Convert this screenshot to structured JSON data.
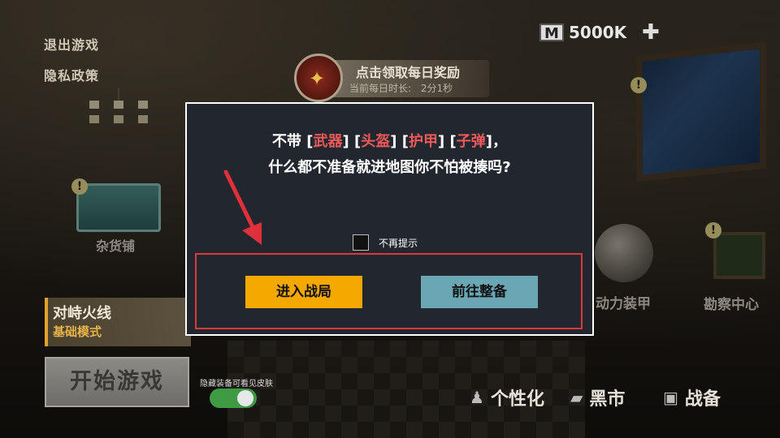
{
  "menu": {
    "exit": "退出游戏",
    "privacy": "隐私政策"
  },
  "currency": {
    "icon": "M",
    "amount": "5000K",
    "add": "✚"
  },
  "reward": {
    "title": "点击领取每日奖励",
    "sub_label": "当前每日时长:",
    "sub_value": "2分1秒"
  },
  "scene": {
    "shop": "杂货铺",
    "armor": "动力装甲",
    "recon": "勘察中心",
    "alert": "!"
  },
  "mode": {
    "title": "对峙火线",
    "subtitle": "基础模式"
  },
  "start_label": "开始游戏",
  "hide_skin_label": "隐藏装备可看见皮肤",
  "hide_skin_on": true,
  "nav": {
    "personalize": "个性化",
    "black_market": "黑市",
    "gear": "战备"
  },
  "dialog": {
    "line1_prefix": "不带 ",
    "items": [
      "武器",
      "头盔",
      "护甲",
      "子弹"
    ],
    "line1_suffix": "，",
    "line2": "什么都不准备就进地图你不怕被揍吗?",
    "checkbox_label": "不再提示",
    "enter_label": "进入战局",
    "prepare_label": "前往整备"
  },
  "colors": {
    "enter_button": "#f5a800",
    "prepare_button": "#6aa6b4",
    "highlight": "#f05a5a",
    "annotation": "#d93a3a"
  }
}
